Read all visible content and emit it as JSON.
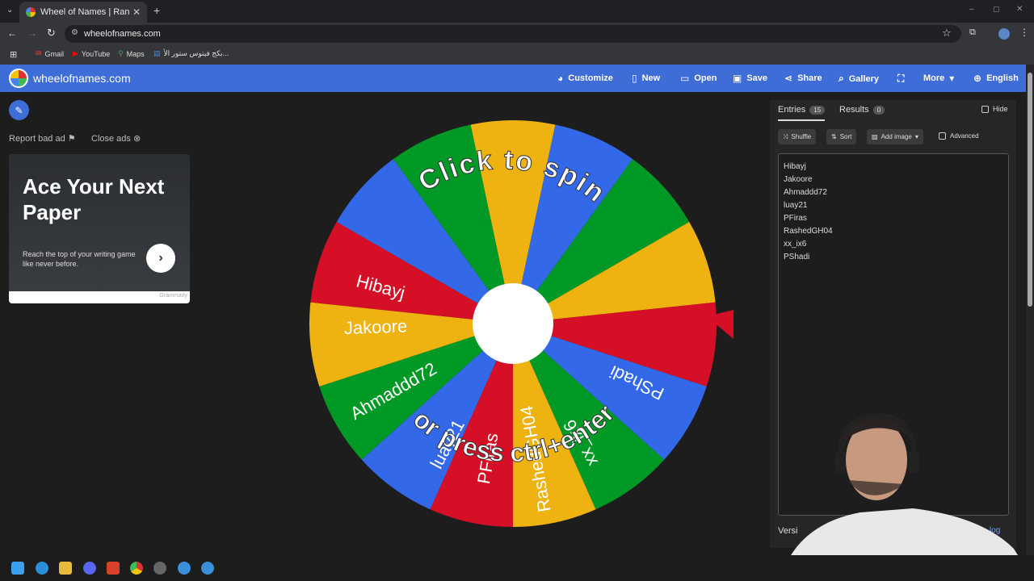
{
  "browser": {
    "tab_title": "Wheel of Names | Random nam",
    "tab_close": "✕",
    "new_tab": "+",
    "url": "wheelofnames.com",
    "bookmarks": [
      {
        "label": "Gmail",
        "icon": "gmail-icon"
      },
      {
        "label": "YouTube",
        "icon": "youtube-icon"
      },
      {
        "label": "Maps",
        "icon": "maps-icon"
      },
      {
        "label": "بكج فيتوس ستور الأ...",
        "icon": "docs-icon"
      }
    ],
    "window_controls": [
      "–",
      "▢",
      "✕"
    ]
  },
  "app": {
    "brand": "wheelofnames.com",
    "nav": [
      {
        "label": "Customize",
        "icon": "palette-icon",
        "glyph": "🎨"
      },
      {
        "label": "New",
        "icon": "file-icon",
        "glyph": "📄"
      },
      {
        "label": "Open",
        "icon": "folder-icon",
        "glyph": "📂"
      },
      {
        "label": "Save",
        "icon": "save-icon",
        "glyph": "💾"
      },
      {
        "label": "Share",
        "icon": "share-icon",
        "glyph": "⤴"
      },
      {
        "label": "Gallery",
        "icon": "search-icon",
        "glyph": "⌕"
      },
      {
        "label": "",
        "icon": "fullscreen-icon",
        "glyph": "⛶"
      },
      {
        "label": "More",
        "icon": "chevron-down-icon",
        "glyph": "▾"
      },
      {
        "label": "English",
        "icon": "globe-icon",
        "glyph": "🌐"
      }
    ]
  },
  "left": {
    "report_label": "Report bad ad",
    "close_ads_label": "Close ads",
    "ad": {
      "headline": "Ace Your Next Paper",
      "body": "Reach the top of your writing game like never before.",
      "brand": "Grammarly"
    }
  },
  "wheel": {
    "top_text": "Click to spin",
    "bottom_text": "or press ctrl+enter",
    "colors": [
      "#3369e8",
      "#009925",
      "#eeb211",
      "#d50f25"
    ],
    "names": [
      "Hibayj",
      "Jakoore",
      "Ahmaddd72",
      "luay21",
      "PFiras",
      "RashedGH04",
      "xx_ix6",
      "PShadi"
    ]
  },
  "panel": {
    "tab_entries": "Entries",
    "entries_count": "15",
    "tab_results": "Results",
    "results_count": "0",
    "hide_label": "Hide",
    "shuffle_label": "Shuffle",
    "sort_label": "Sort",
    "add_image_label": "Add image",
    "advanced_label": "Advanced",
    "entries": [
      "Hibayj",
      "Jakoore",
      "Ahmaddd72",
      "luay21",
      "PFiras",
      "RashedGH04",
      "xx_ix6",
      "PShadi"
    ],
    "version_label": "Versi",
    "changelog_label": "log"
  }
}
